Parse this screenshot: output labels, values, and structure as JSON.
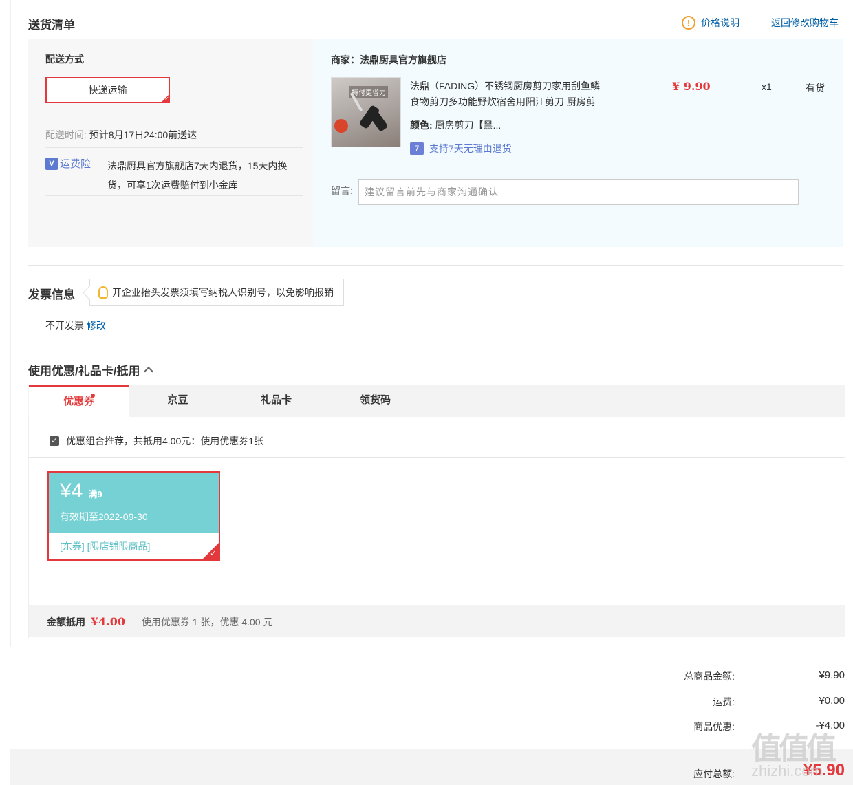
{
  "shipping": {
    "title": "送货清单",
    "price_note_icon": "exclamation-circle-icon",
    "price_note_label": "价格说明",
    "back_to_cart": "返回修改购物车",
    "method_label": "配送方式",
    "method_value": "快递运输",
    "time_label": "配送时间:",
    "time_value": "预计8月17日24:00前送达",
    "insurance_badge": "运费险",
    "insurance_text_1": "法鼎厨具官方旗舰店7天内退货，15天内换",
    "insurance_text_2": "货，可享1次运费赔付到小金库"
  },
  "merchant": {
    "label": "商家：",
    "name": "法鼎厨具官方旗舰店",
    "product": {
      "title_line1": "法鼎（FADING）不锈钢厨房剪刀家用刮鱼鳞",
      "title_line2": "食物剪刀多功能野炊宿舍用阳江剪刀 厨房剪",
      "color_label": "颜色:",
      "color_value": "厨房剪刀【黑...",
      "price": "¥ 9.90",
      "qty": "x1",
      "stock": "有货",
      "return_policy": "支持7天无理由退货",
      "img_text": "持付更省力"
    },
    "note_label": "留言:",
    "note_placeholder": "建议留言前先与商家沟通确认"
  },
  "invoice": {
    "title": "发票信息",
    "tip": "开企业抬头发票须填写纳税人识别号，以免影响报销",
    "status": "不开发票",
    "edit": "修改"
  },
  "discount": {
    "title": "使用优惠/礼品卡/抵用",
    "tabs": [
      "优惠券",
      "京豆",
      "礼品卡",
      "领货码"
    ],
    "combo_text": "优惠组合推荐，共抵用4.00元：使用优惠券1张",
    "coupon": {
      "amount": "¥4",
      "condition": "满9",
      "validity": "有效期至2022-09-30",
      "tags": "[东券] [限店铺限商品]"
    },
    "deduct_label": "金额抵用",
    "deduct_value": "¥4.00",
    "deduct_desc": "使用优惠券 1 张，优惠 4.00 元"
  },
  "summary": {
    "rows": [
      {
        "label": "总商品金额:",
        "value": "¥9.90"
      },
      {
        "label": "运费:",
        "value": "¥0.00"
      },
      {
        "label": "商品优惠:",
        "value": "-¥4.00"
      }
    ],
    "payable_label": "应付总额:",
    "payable_value": "¥5.90"
  },
  "watermark": {
    "glyphs": "值值值",
    "domain": "zhizhi.com"
  },
  "colors": {
    "accent": "#e4393c",
    "link": "#005ea7",
    "coupon": "#76d1d4"
  }
}
